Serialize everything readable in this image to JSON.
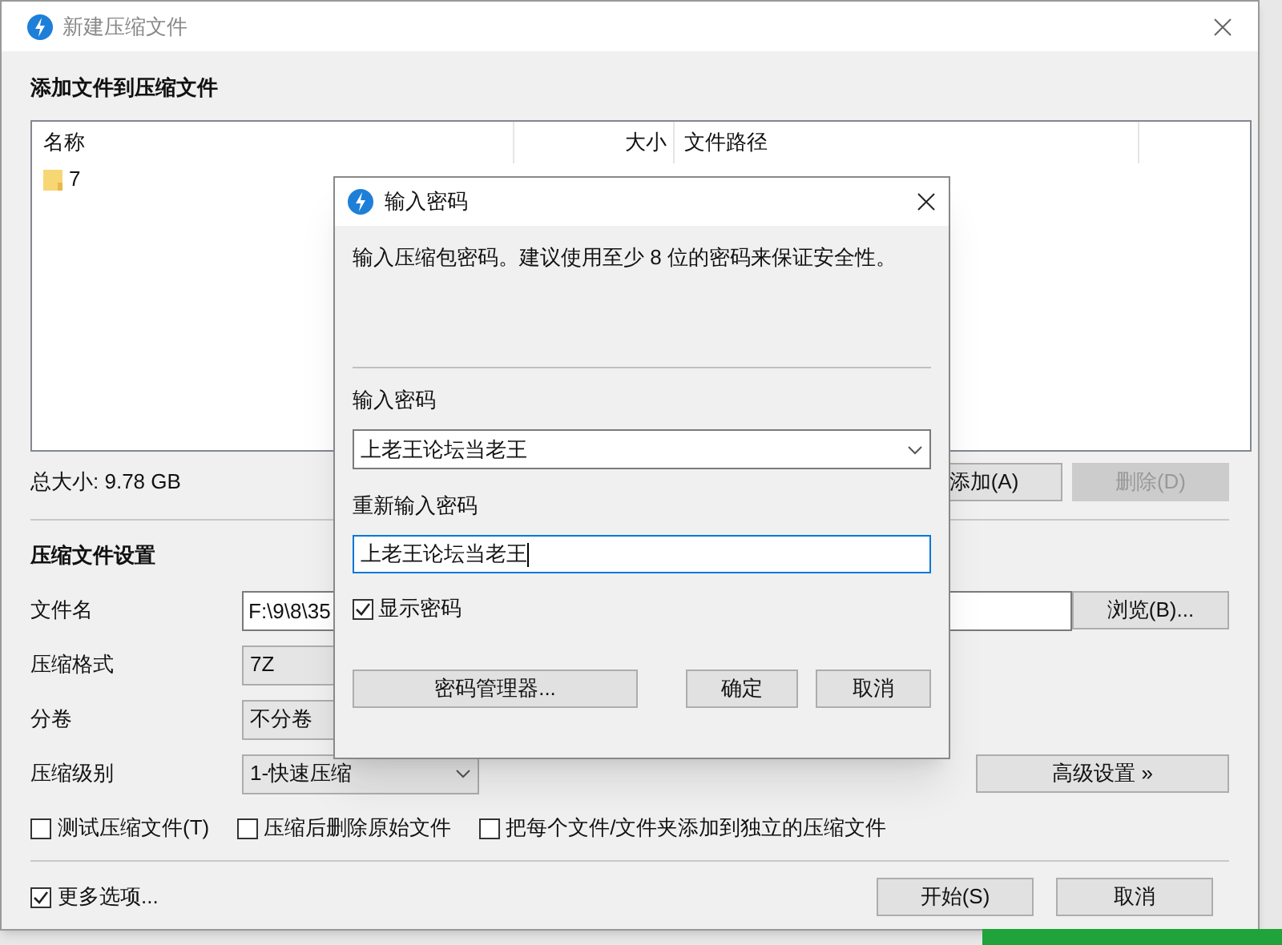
{
  "window": {
    "title": "新建压缩文件"
  },
  "files_section": {
    "heading": "添加文件到压缩文件",
    "columns": [
      "名称",
      "大小",
      "文件路径"
    ],
    "rows": [
      {
        "name": "7"
      }
    ],
    "total": "总大小: 9.78 GB",
    "buttons": [
      {
        "label": "添加(A)",
        "disabled": false
      },
      {
        "label": "删除(D)",
        "disabled": true
      }
    ]
  },
  "settings": {
    "heading": "压缩文件设置",
    "fields": [
      {
        "kind": "input",
        "label": "文件名",
        "value": "F:\\9\\8\\35",
        "button": "浏览(B)..."
      },
      {
        "kind": "select",
        "label": "压缩格式",
        "value": "7Z"
      },
      {
        "kind": "select",
        "label": "分卷",
        "value": "不分卷"
      },
      {
        "kind": "select",
        "label": "压缩级别",
        "value": "1-快速压缩",
        "arrow": true,
        "button": "高级设置 »"
      }
    ],
    "checkboxes": [
      {
        "label": "测试压缩文件(T)",
        "checked": false
      },
      {
        "label": "压缩后删除原始文件",
        "checked": false
      },
      {
        "label": "把每个文件/文件夹添加到独立的压缩文件",
        "checked": false
      }
    ]
  },
  "footer": {
    "more_options": {
      "label": "更多选项...",
      "checked": true
    },
    "buttons": [
      "开始(S)",
      "取消"
    ]
  },
  "dialog": {
    "title": "输入密码",
    "message": "输入压缩包密码。建议使用至少 8 位的密码来保证安全性。",
    "password_label": "输入密码",
    "password": "上老王论坛当老王",
    "confirm_label": "重新输入密码",
    "confirm": "上老王论坛当老王",
    "show_password": {
      "label": "显示密码",
      "checked": true
    },
    "buttons": [
      "密码管理器...",
      "确定",
      "取消"
    ]
  }
}
